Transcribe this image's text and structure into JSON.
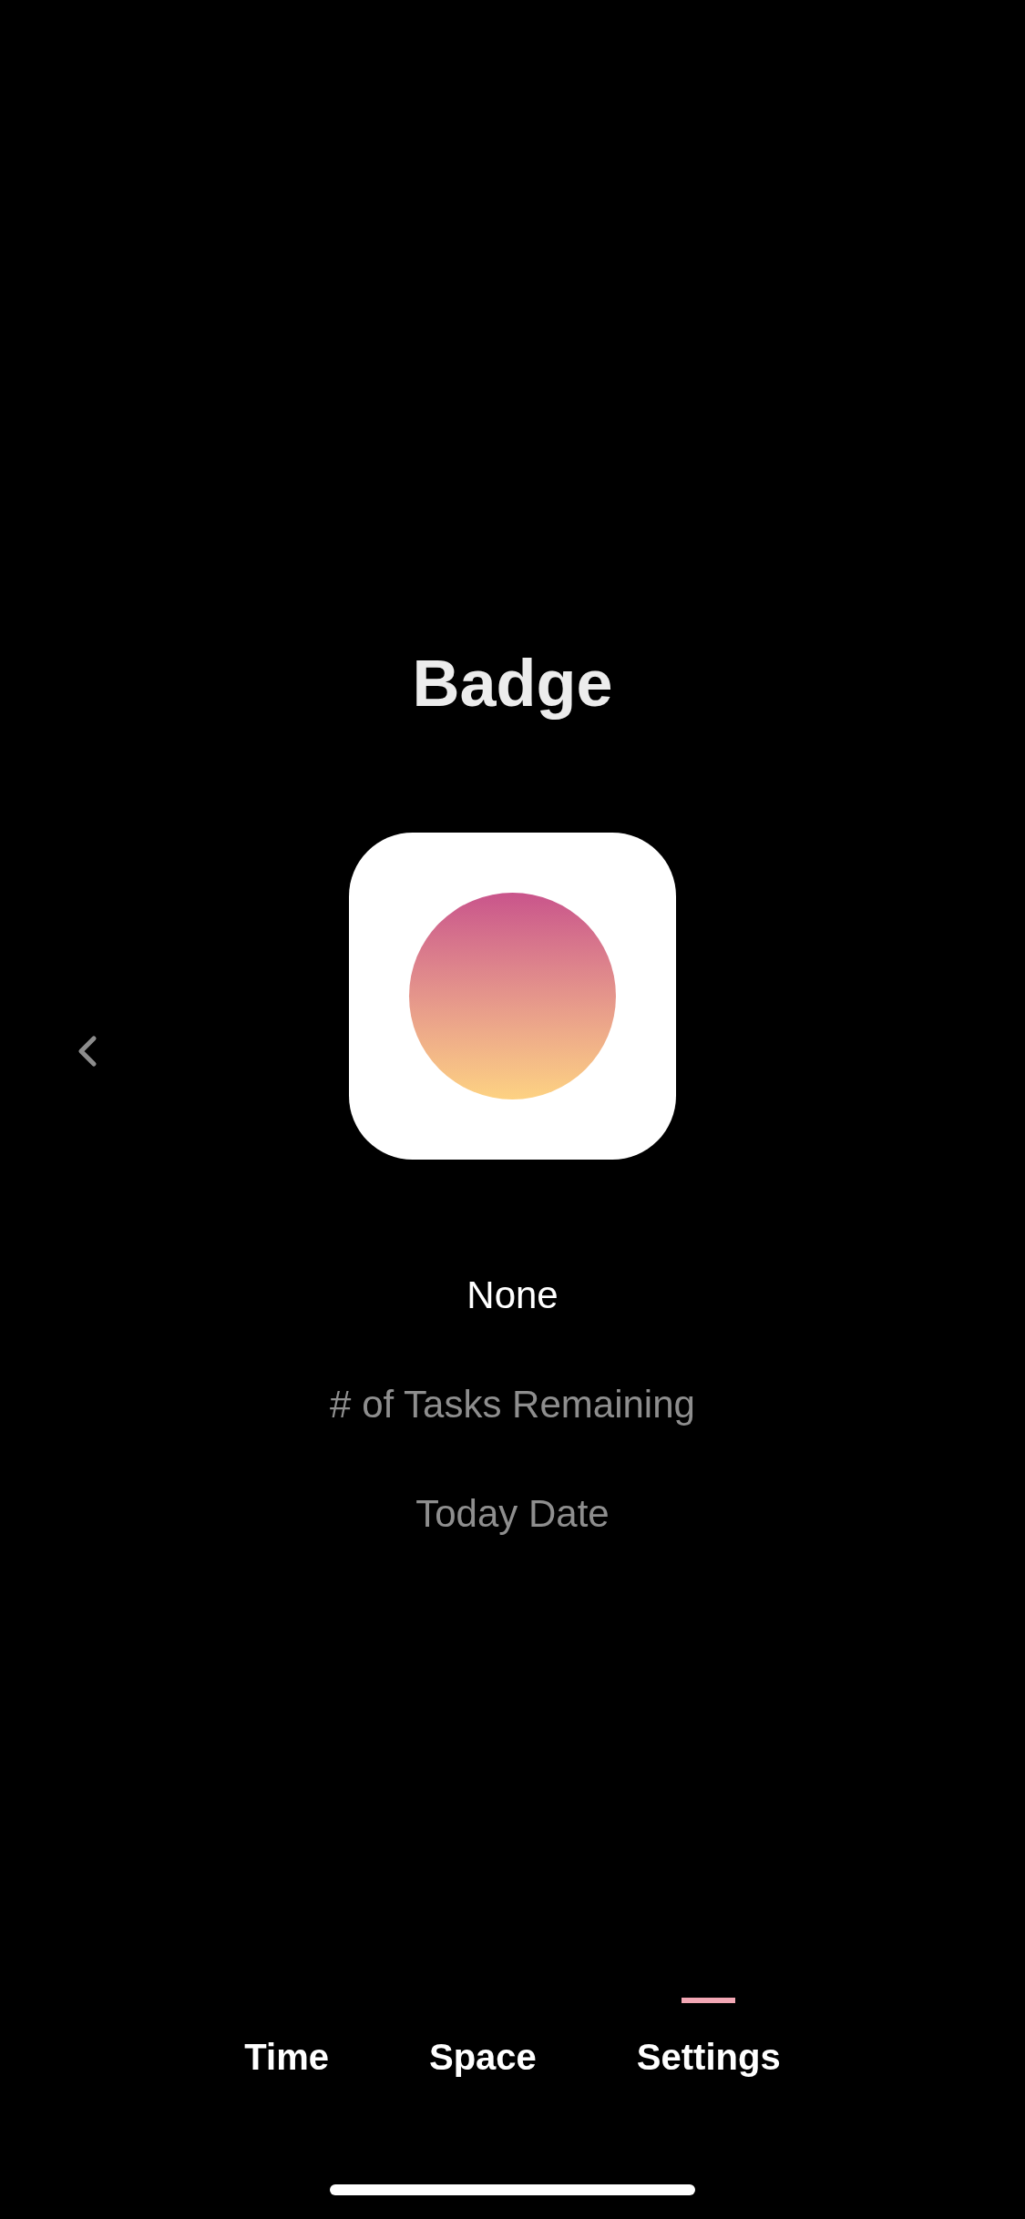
{
  "title": "Badge",
  "options": [
    {
      "label": "None",
      "selected": true
    },
    {
      "label": "# of Tasks Remaining",
      "selected": false
    },
    {
      "label": "Today Date",
      "selected": false
    }
  ],
  "tabs": [
    {
      "label": "Time",
      "selected": false
    },
    {
      "label": "Space",
      "selected": false
    },
    {
      "label": "Settings",
      "selected": true
    }
  ]
}
